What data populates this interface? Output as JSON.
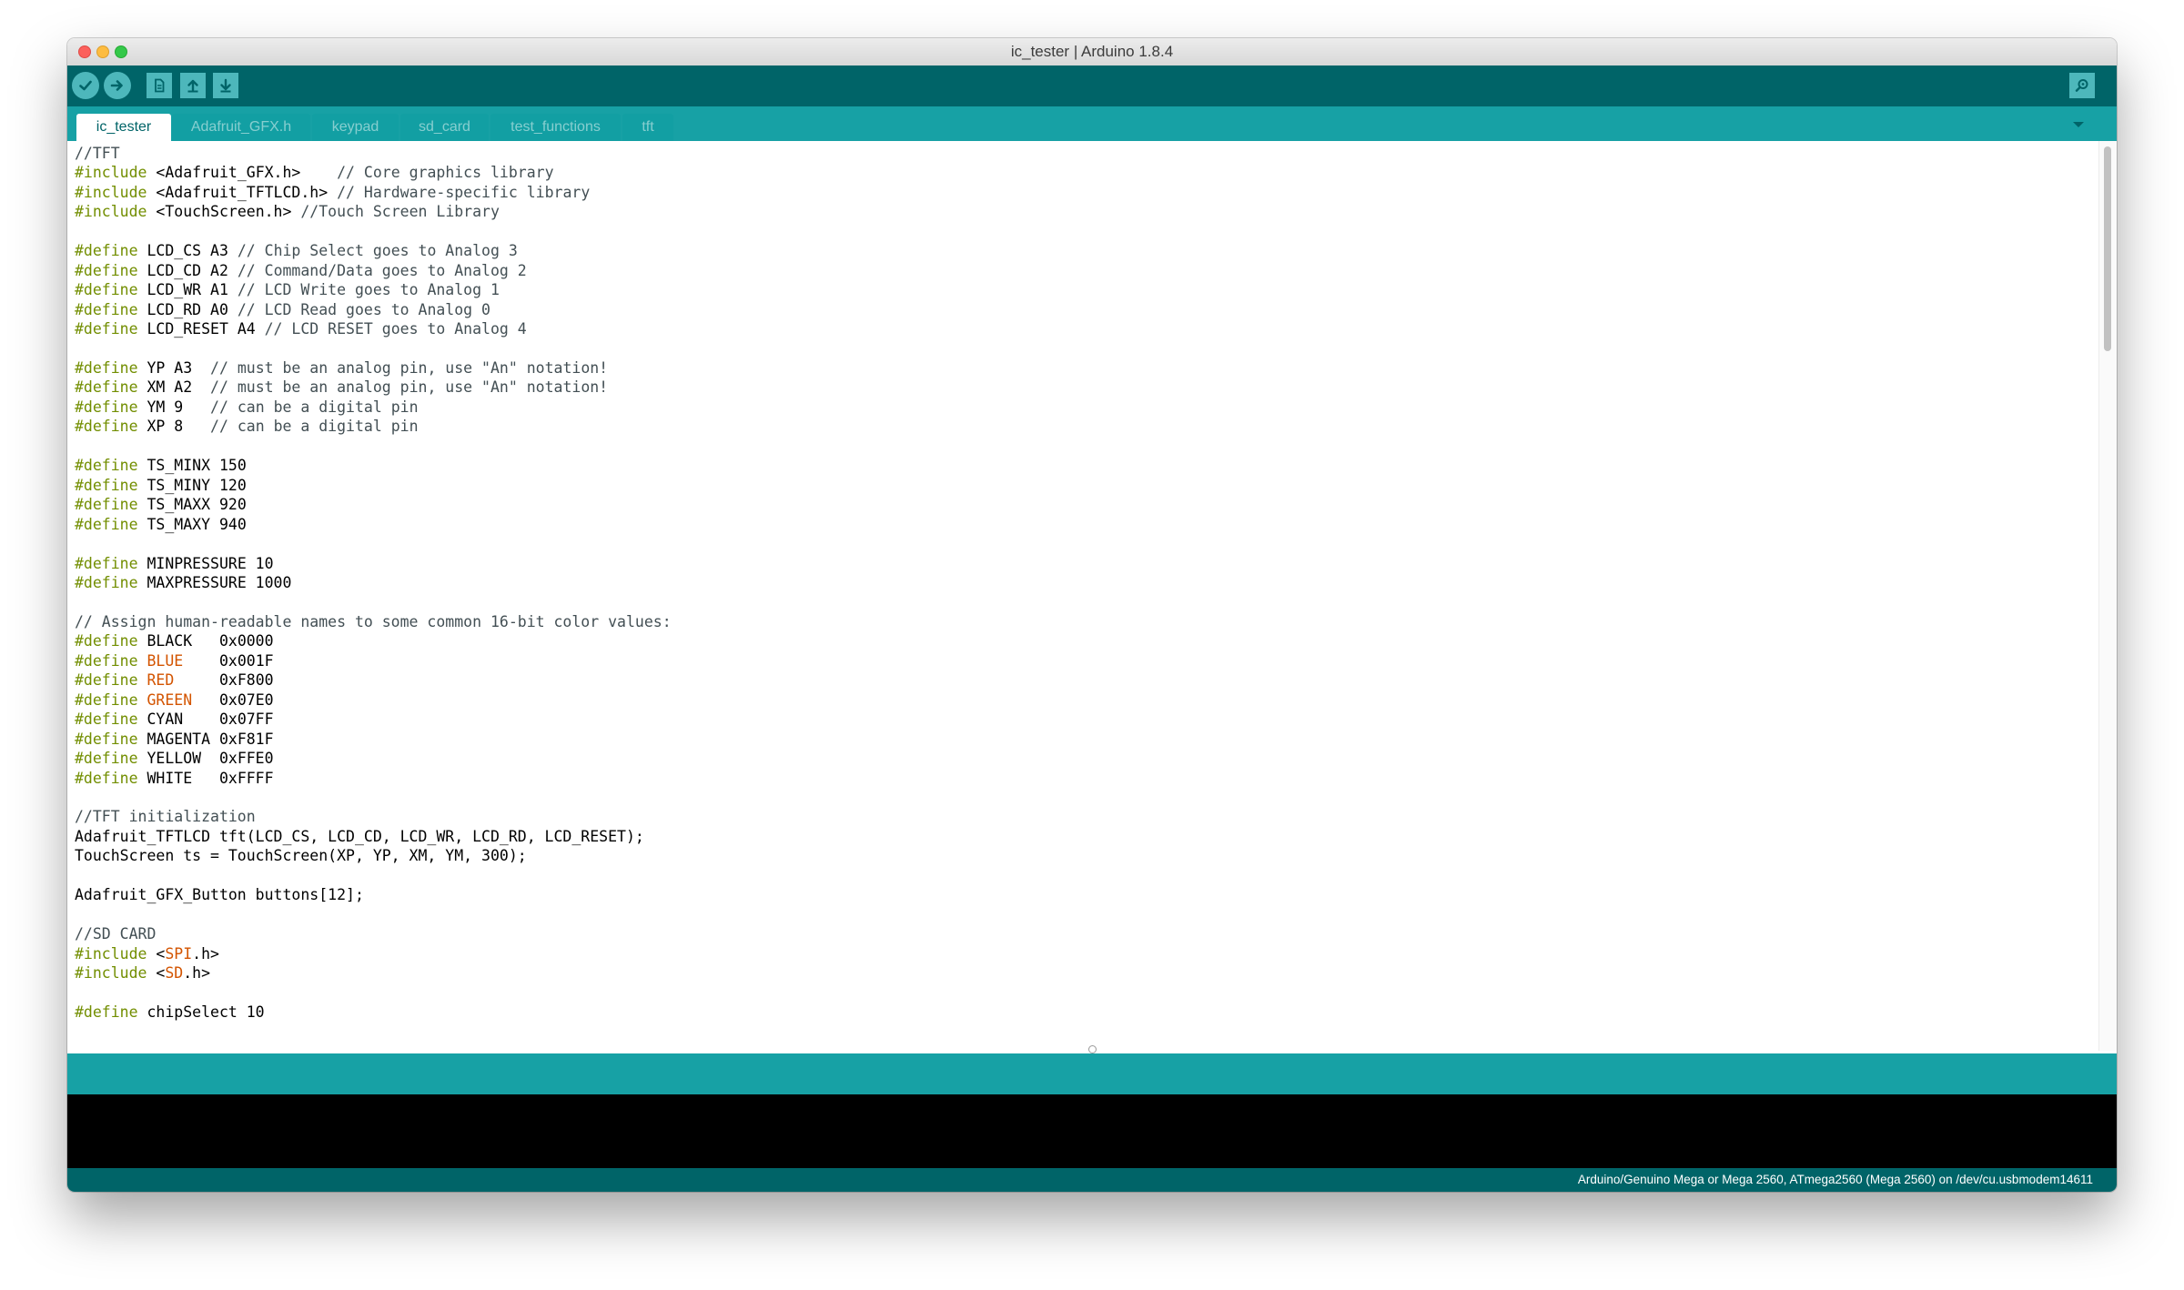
{
  "window": {
    "title": "ic_tester | Arduino 1.8.4"
  },
  "toolbar": {
    "buttons": [
      {
        "name": "verify-icon"
      },
      {
        "name": "upload-icon"
      },
      {
        "name": "new-icon"
      },
      {
        "name": "open-icon"
      },
      {
        "name": "save-icon"
      }
    ],
    "serial_monitor": "magnifier-icon"
  },
  "tabs": [
    {
      "label": "ic_tester",
      "active": true
    },
    {
      "label": "Adafruit_GFX.h",
      "active": false
    },
    {
      "label": "keypad",
      "active": false
    },
    {
      "label": "sd_card",
      "active": false
    },
    {
      "label": "test_functions",
      "active": false
    },
    {
      "label": "tft",
      "active": false
    }
  ],
  "editor": {
    "lines": [
      [
        [
          "c",
          "//TFT"
        ]
      ],
      [
        [
          "k",
          "#include"
        ],
        [
          "p",
          " <Adafruit_GFX.h>    "
        ],
        [
          "c",
          "// Core graphics library"
        ]
      ],
      [
        [
          "k",
          "#include"
        ],
        [
          "p",
          " <Adafruit_TFTLCD.h> "
        ],
        [
          "c",
          "// Hardware-specific library"
        ]
      ],
      [
        [
          "k",
          "#include"
        ],
        [
          "p",
          " <TouchScreen.h> "
        ],
        [
          "c",
          "//Touch Screen Library"
        ]
      ],
      [],
      [
        [
          "k",
          "#define"
        ],
        [
          "p",
          " LCD_CS A3 "
        ],
        [
          "c",
          "// Chip Select goes to Analog 3"
        ]
      ],
      [
        [
          "k",
          "#define"
        ],
        [
          "p",
          " LCD_CD A2 "
        ],
        [
          "c",
          "// Command/Data goes to Analog 2"
        ]
      ],
      [
        [
          "k",
          "#define"
        ],
        [
          "p",
          " LCD_WR A1 "
        ],
        [
          "c",
          "// LCD Write goes to Analog 1"
        ]
      ],
      [
        [
          "k",
          "#define"
        ],
        [
          "p",
          " LCD_RD A0 "
        ],
        [
          "c",
          "// LCD Read goes to Analog 0"
        ]
      ],
      [
        [
          "k",
          "#define"
        ],
        [
          "p",
          " LCD_RESET A4 "
        ],
        [
          "c",
          "// LCD RESET goes to Analog 4"
        ]
      ],
      [],
      [
        [
          "k",
          "#define"
        ],
        [
          "p",
          " YP A3  "
        ],
        [
          "c",
          "// must be an analog pin, use \"An\" notation!"
        ]
      ],
      [
        [
          "k",
          "#define"
        ],
        [
          "p",
          " XM A2  "
        ],
        [
          "c",
          "// must be an analog pin, use \"An\" notation!"
        ]
      ],
      [
        [
          "k",
          "#define"
        ],
        [
          "p",
          " YM 9   "
        ],
        [
          "c",
          "// can be a digital pin"
        ]
      ],
      [
        [
          "k",
          "#define"
        ],
        [
          "p",
          " XP 8   "
        ],
        [
          "c",
          "// can be a digital pin"
        ]
      ],
      [],
      [
        [
          "k",
          "#define"
        ],
        [
          "p",
          " TS_MINX 150"
        ]
      ],
      [
        [
          "k",
          "#define"
        ],
        [
          "p",
          " TS_MINY 120"
        ]
      ],
      [
        [
          "k",
          "#define"
        ],
        [
          "p",
          " TS_MAXX 920"
        ]
      ],
      [
        [
          "k",
          "#define"
        ],
        [
          "p",
          " TS_MAXY 940"
        ]
      ],
      [],
      [
        [
          "k",
          "#define"
        ],
        [
          "p",
          " MINPRESSURE 10"
        ]
      ],
      [
        [
          "k",
          "#define"
        ],
        [
          "p",
          " MAXPRESSURE 1000"
        ]
      ],
      [],
      [
        [
          "c",
          "// Assign human-readable names to some common 16-bit color values:"
        ]
      ],
      [
        [
          "k",
          "#define"
        ],
        [
          "p",
          " BLACK   0x0000"
        ]
      ],
      [
        [
          "k",
          "#define"
        ],
        [
          "p",
          " "
        ],
        [
          "o",
          "BLUE"
        ],
        [
          "p",
          "    0x001F"
        ]
      ],
      [
        [
          "k",
          "#define"
        ],
        [
          "p",
          " "
        ],
        [
          "o",
          "RED"
        ],
        [
          "p",
          "     0xF800"
        ]
      ],
      [
        [
          "k",
          "#define"
        ],
        [
          "p",
          " "
        ],
        [
          "o",
          "GREEN"
        ],
        [
          "p",
          "   0x07E0"
        ]
      ],
      [
        [
          "k",
          "#define"
        ],
        [
          "p",
          " CYAN    0x07FF"
        ]
      ],
      [
        [
          "k",
          "#define"
        ],
        [
          "p",
          " MAGENTA 0xF81F"
        ]
      ],
      [
        [
          "k",
          "#define"
        ],
        [
          "p",
          " YELLOW  0xFFE0"
        ]
      ],
      [
        [
          "k",
          "#define"
        ],
        [
          "p",
          " WHITE   0xFFFF"
        ]
      ],
      [],
      [
        [
          "c",
          "//TFT initialization"
        ]
      ],
      [
        [
          "p",
          "Adafruit_TFTLCD tft(LCD_CS, LCD_CD, LCD_WR, LCD_RD, LCD_RESET);"
        ]
      ],
      [
        [
          "p",
          "TouchScreen ts = TouchScreen(XP, YP, XM, YM, 300);"
        ]
      ],
      [],
      [
        [
          "p",
          "Adafruit_GFX_Button buttons[12];"
        ]
      ],
      [],
      [
        [
          "c",
          "//SD CARD"
        ]
      ],
      [
        [
          "k",
          "#include"
        ],
        [
          "p",
          " <"
        ],
        [
          "o",
          "SPI"
        ],
        [
          "p",
          ".h>"
        ]
      ],
      [
        [
          "k",
          "#include"
        ],
        [
          "p",
          " <"
        ],
        [
          "o",
          "SD"
        ],
        [
          "p",
          ".h>"
        ]
      ],
      [],
      [
        [
          "k",
          "#define"
        ],
        [
          "p",
          " chipSelect 10"
        ]
      ]
    ]
  },
  "console": {
    "message": ""
  },
  "status": {
    "board": "Arduino/Genuino Mega or Mega 2560, ATmega2560 (Mega 2560) on /dev/cu.usbmodem14611"
  },
  "colors": {
    "toolbar": "#006468",
    "tabbar": "#17a1a5",
    "keyword": "#728e00",
    "constant": "#d35400",
    "comment": "#434f54"
  }
}
